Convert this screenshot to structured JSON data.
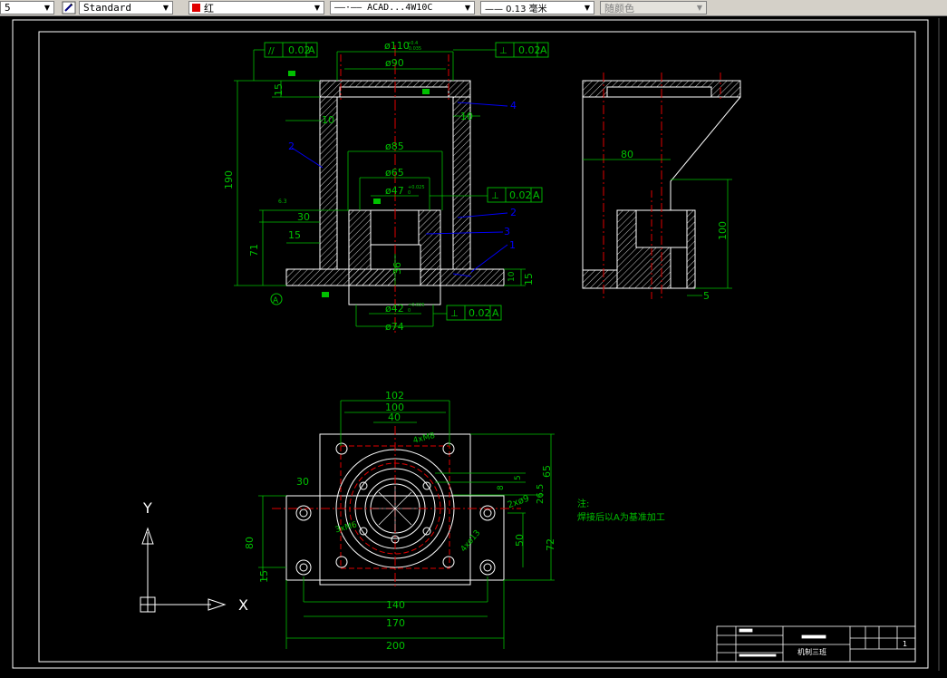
{
  "toolbar": {
    "style_prefix": "5",
    "text_style": "Standard",
    "color_name": "红",
    "color_hex": "#e00000",
    "linetype": "——·—— ACAD...4W10C",
    "lineweight": "—— 0.13 毫米",
    "plotstyle": "随颜色"
  },
  "drawing": {
    "front_dims": {
      "tol_top_left": "0.02",
      "datum_a": "A",
      "dia110": "ø110",
      "dia110_tol_up": "+0.4",
      "dia110_tol_low": "-0.035",
      "tol_top_right": "0.02",
      "dia90": "ø90",
      "dim15_top": "15",
      "dim190": "190",
      "dim10_left": "10",
      "dim10_right": "10",
      "dia85": "ø85",
      "dia65": "ø65",
      "dia47": "ø47",
      "dia47_tol_up": "+0.025",
      "dia47_tol_low": "0",
      "tol_mid": "0.02",
      "dim30": "30",
      "dim15_mid": "15",
      "dim71": "71",
      "dim36": "36",
      "dim10_br": "10",
      "dim15_br": "15",
      "dia42": "ø42",
      "dia42_tol_up": "+0.025",
      "dia42_tol_low": "0",
      "tol_bottom": "0.02",
      "dia74": "ø74",
      "rough": "6.3",
      "lbl1": "1",
      "lbl2a": "2",
      "lbl2b": "2",
      "lbl3": "3",
      "lbl4": "4"
    },
    "side_dims": {
      "dim80": "80",
      "dim100": "100",
      "dim5": "5"
    },
    "top_dims": {
      "dim102": "102",
      "dim100": "100",
      "dim40": "40",
      "holes_m8": "4xM8",
      "dim65": "65",
      "dim5": "5",
      "dim8": "8",
      "dim26_5": "26.5",
      "dim30": "30",
      "holes_right": "2xø9",
      "holes_m6": "3xM6",
      "holes_dia": "4xø13",
      "dim80": "80",
      "dim15": "15",
      "dim50": "50",
      "dim72": "72",
      "dim140": "140",
      "dim170": "170",
      "dim200": "200"
    },
    "note_title": "注:",
    "note_text": "焊接后以A为基准加工",
    "ucs_x": "X",
    "ucs_y": "Y",
    "title_block_name": "机制三班",
    "title_block_scale": "1"
  }
}
